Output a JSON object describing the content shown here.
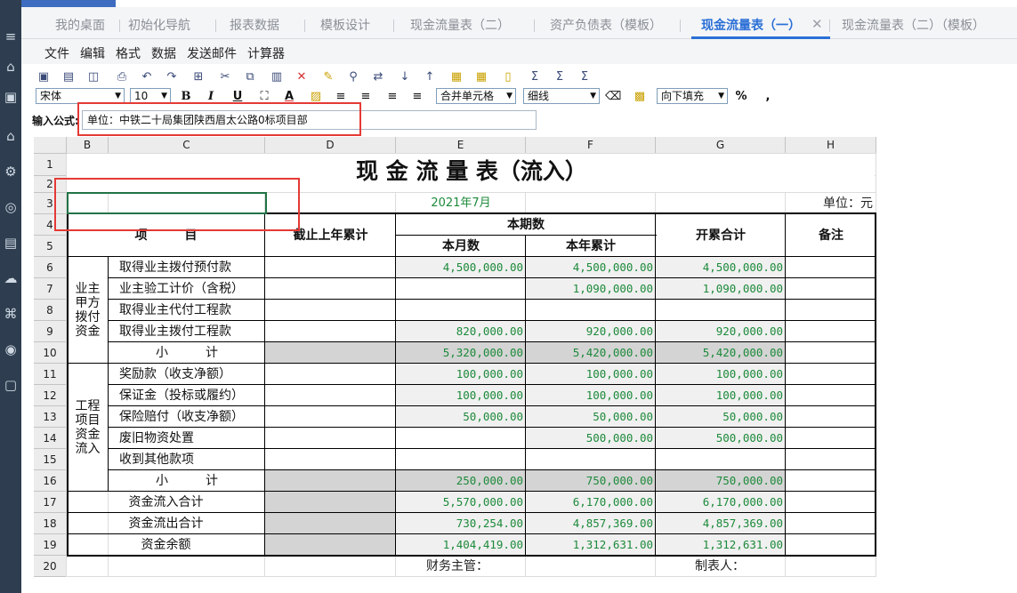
{
  "tabs": [
    {
      "label": "我的桌面"
    },
    {
      "label": "初始化导航"
    },
    {
      "label": "报表数据"
    },
    {
      "label": "模板设计"
    },
    {
      "label": "现金流量表（二）"
    },
    {
      "label": "资产负债表（模板）"
    },
    {
      "label": "现金流量表（一）"
    },
    {
      "label": "现金流量表（二）（模板）"
    }
  ],
  "active_tab": "现金流量表（一）",
  "menu": [
    "文件",
    "编辑",
    "格式",
    "数据",
    "发送邮件",
    "计算器"
  ],
  "toolbar": {
    "font": "宋体",
    "size": "10",
    "bold": "B",
    "italic": "I",
    "underline": "U",
    "color_a": "A",
    "merge": "合并单元格",
    "line": "细线",
    "fill": "向下填充",
    "percent": "%",
    "comma": ","
  },
  "formula": {
    "label": "输入公式:",
    "value": "单位：中铁二十局集团陕西眉太公路0标项目部"
  },
  "columns": [
    "B",
    "C",
    "D",
    "E",
    "F",
    "G",
    "H"
  ],
  "rows": [
    "1",
    "2",
    "3",
    "4",
    "5",
    "6",
    "7",
    "8",
    "9",
    "10",
    "11",
    "12",
    "13",
    "14",
    "15",
    "16",
    "17",
    "18",
    "19",
    "20"
  ],
  "report": {
    "title": "现 金 流 量 表（流入）",
    "period": "2021年7月",
    "unit": "单位：元",
    "h_item": "项　　　目",
    "h_prev": "截止上年累计",
    "h_current": "本期数",
    "h_month": "本月数",
    "h_year": "本年累计",
    "h_total": "开累合计",
    "h_note": "备注",
    "group1": "业主甲方拨付资金",
    "group2": "工程项目资金流入",
    "finance": "财务主管：",
    "maker": "制表人："
  },
  "data_rows": [
    {
      "label": "取得业主拨付预付款",
      "month": "4,500,000.00",
      "year": "4,500,000.00",
      "total": "4,500,000.00"
    },
    {
      "label": "业主验工计价（含税）",
      "month": "",
      "year": "1,090,000.00",
      "total": "1,090,000.00"
    },
    {
      "label": "取得业主代付工程款",
      "month": "",
      "year": "",
      "total": ""
    },
    {
      "label": "取得业主拨付工程款",
      "month": "820,000.00",
      "year": "920,000.00",
      "total": "920,000.00"
    },
    {
      "label": "小　　　计",
      "month": "5,320,000.00",
      "year": "5,420,000.00",
      "total": "5,420,000.00"
    },
    {
      "label": "奖励款（收支净额）",
      "month": "100,000.00",
      "year": "100,000.00",
      "total": "100,000.00"
    },
    {
      "label": "保证金（投标或履约）",
      "month": "100,000.00",
      "year": "100,000.00",
      "total": "100,000.00"
    },
    {
      "label": "保险赔付（收支净额）",
      "month": "50,000.00",
      "year": "50,000.00",
      "total": "50,000.00"
    },
    {
      "label": "废旧物资处置",
      "month": "",
      "year": "500,000.00",
      "total": "500,000.00"
    },
    {
      "label": "收到其他款项",
      "month": "",
      "year": "",
      "total": ""
    },
    {
      "label": "小　　　计",
      "month": "250,000.00",
      "year": "750,000.00",
      "total": "750,000.00"
    },
    {
      "label": "资金流入合计",
      "month": "5,570,000.00",
      "year": "6,170,000.00",
      "total": "6,170,000.00"
    },
    {
      "label": "资金流出合计",
      "month": "730,254.00",
      "year": "4,857,369.00",
      "total": "4,857,369.00"
    },
    {
      "label": "资金余额",
      "month": "1,404,419.00",
      "year": "1,312,631.00",
      "total": "1,312,631.00"
    }
  ]
}
